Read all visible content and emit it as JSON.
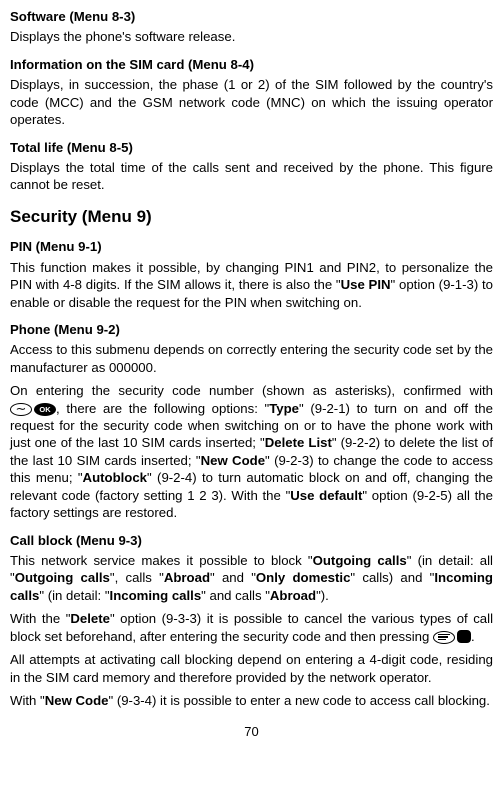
{
  "s1": {
    "title": "Software (Menu 8-3)",
    "p1": "Displays the phone's software release."
  },
  "s2": {
    "title": "Information on the SIM card (Menu 8-4)",
    "p1": "Displays, in succession, the phase (1 or 2) of the SIM followed by the country's code (MCC) and the GSM network code (MNC) on which the issuing operator operates."
  },
  "s3": {
    "title": "Total life (Menu 8-5)",
    "p1": "Displays the total time of the calls sent and received by the phone. This figure cannot be reset."
  },
  "h2": "Security (Menu 9)",
  "s4": {
    "title": "PIN (Menu 9-1)",
    "p1a": "This function makes it possible, by changing PIN1 and PIN2, to personalize the PIN with 4-8 digits. If the SIM allows it, there is also the \"",
    "p1b": "Use PIN",
    "p1c": "\" option (9-1-3) to enable or disable the request for the PIN when switching on."
  },
  "s5": {
    "title": "Phone (Menu 9-2)",
    "p1": "Access to this submenu depends on correctly entering the security code set by the manufacturer as 000000.",
    "p2a": "On entering the security code number (shown as asterisks), confirmed with ",
    "p2b": ", there are the following options: \"",
    "type": "Type",
    "p2c": "\" (9-2-1) to turn on and off the request for the security code when switching on or to have the phone work with just one of the last 10 SIM cards inserted; \"",
    "deletelist": "Delete List",
    "p2d": "\" (9-2-2) to delete the list of the last 10 SIM cards inserted; \"",
    "newcode": "New Code",
    "p2e": "\" (9-2-3) to change the code to access this menu; \"",
    "autoblock": "Autoblock",
    "p2f": "\" (9-2-4) to turn automatic block on and off, changing the relevant code (factory setting 1 2 3). With the \"",
    "usedefault": "Use default",
    "p2g": "\" option (9-2-5) all the factory settings are restored."
  },
  "s6": {
    "title": "Call block (Menu 9-3)",
    "p1a": "This network service makes it possible to block \"",
    "og": "Outgoing calls",
    "p1b": "\" (in detail: all \"",
    "og2": "Outgoing calls",
    "p1c": "\", calls \"",
    "abroad": "Abroad",
    "p1d": "\" and \"",
    "od": "Only domestic",
    "p1e": "\" calls) and \"",
    "ic": "Incoming calls",
    "p1f": "\" (in detail: \"",
    "ic2": "Incoming calls",
    "p1g": "\" and calls \"",
    "abroad2": "Abroad",
    "p1h": "\").",
    "p2a": "With the \"",
    "delete": "Delete",
    "p2b": "\" option (9-3-3) it is possible to cancel the various types of call block set beforehand, after entering the security code and then pressing ",
    "p2c": ".",
    "p3": "All attempts at activating call blocking depend on entering a 4-digit code, residing in the SIM card memory and therefore provided by the network operator.",
    "p4a": "With \"",
    "nc": "New Code",
    "p4b": "\" (9-3-4) it is possible to enter a new code to access call blocking."
  },
  "page": "70"
}
